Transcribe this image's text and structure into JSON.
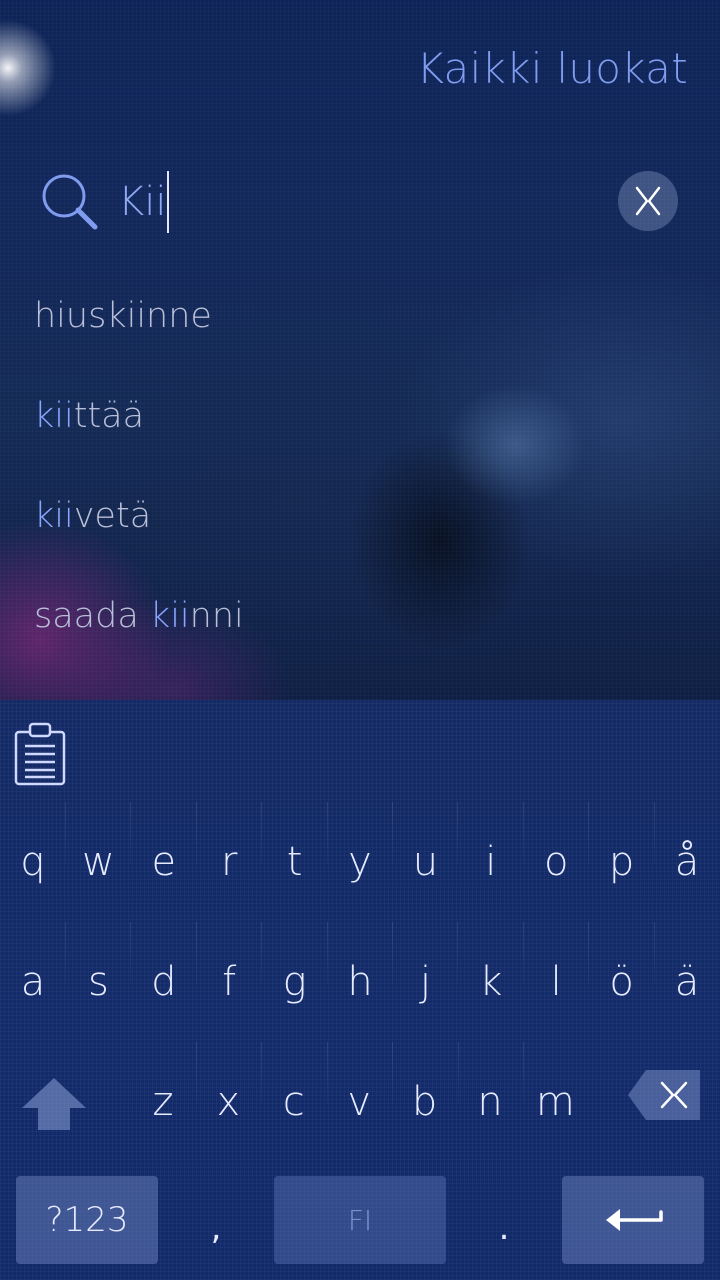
{
  "header": {
    "category": "Kaikki luokat"
  },
  "search": {
    "query": "Kii"
  },
  "suggestions": [
    {
      "pre": "hius",
      "match": "",
      "post": "kiinne",
      "style": "plain"
    },
    {
      "pre": "",
      "match": "kii",
      "post": "ttää",
      "style": "match"
    },
    {
      "pre": "",
      "match": "kii",
      "post": "vetä",
      "style": "match"
    },
    {
      "pre": "saada ",
      "match": "kii",
      "post": "nni",
      "style": "match"
    }
  ],
  "keyboard": {
    "row1": [
      "q",
      "w",
      "e",
      "r",
      "t",
      "y",
      "u",
      "i",
      "o",
      "p",
      "å"
    ],
    "row2": [
      "a",
      "s",
      "d",
      "f",
      "g",
      "h",
      "j",
      "k",
      "l",
      "ö",
      "ä"
    ],
    "row3": [
      "z",
      "x",
      "c",
      "v",
      "b",
      "n",
      "m"
    ],
    "symbols_label": "?123",
    "comma": ",",
    "period": ".",
    "language_label": "FI"
  },
  "icons": {
    "search": "search-icon",
    "clear": "clear-icon",
    "clipboard": "clipboard-icon",
    "shift": "shift-icon",
    "backspace": "backspace-icon",
    "enter": "enter-icon"
  },
  "colors": {
    "accent": "#7f9cf0",
    "highlight": "#8aa6ff",
    "text": "#b9bfd8"
  }
}
